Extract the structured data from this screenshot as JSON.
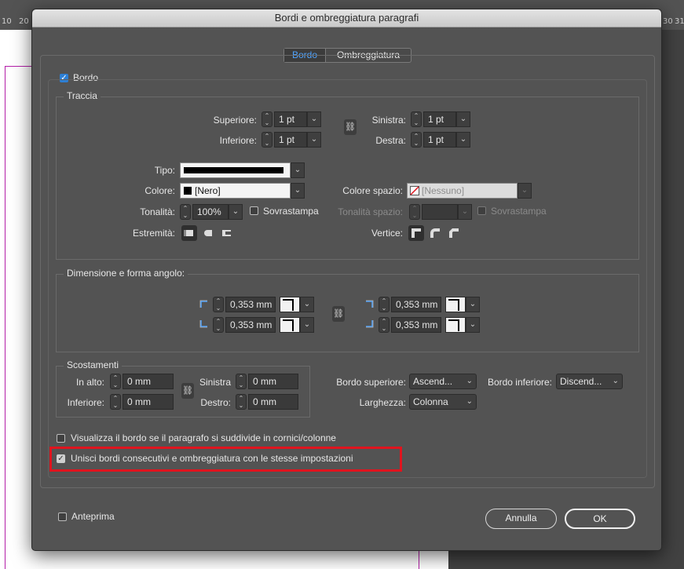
{
  "ruler": {
    "left_numbers": [
      "10",
      "20"
    ],
    "right_numbers": [
      "30",
      "31"
    ]
  },
  "dialog": {
    "title": "Bordi e ombreggiatura paragrafi",
    "tabs": [
      {
        "label": "Bordo",
        "active": true
      },
      {
        "label": "Ombreggiatura",
        "active": false
      }
    ],
    "border_checkbox": {
      "label": "Bordo",
      "checked": true
    },
    "stroke": {
      "group_label": "Traccia",
      "top_label": "Superiore:",
      "top_value": "1 pt",
      "bottom_label": "Inferiore:",
      "bottom_value": "1 pt",
      "left_label": "Sinistra:",
      "left_value": "1 pt",
      "right_label": "Destra:",
      "right_value": "1 pt",
      "type_label": "Tipo:",
      "color_label": "Colore:",
      "color_value": "[Nero]",
      "tint_label": "Tonalità:",
      "tint_value": "100%",
      "overprint_label": "Sovrastampa",
      "gap_color_label": "Colore spazio:",
      "gap_color_value": "[Nessuno]",
      "gap_tint_label": "Tonalità spazio:",
      "gap_overprint_label": "Sovrastampa",
      "caps_label": "Estremità:",
      "join_label": "Vertice:"
    },
    "corners": {
      "group_label": "Dimensione e forma angolo:",
      "top_left_value": "0,353 mm",
      "bottom_left_value": "0,353 mm",
      "top_right_value": "0,353 mm",
      "bottom_right_value": "0,353 mm"
    },
    "offsets": {
      "group_label": "Scostamenti",
      "top_label": "In alto:",
      "top_value": "0 mm",
      "bottom_label": "Inferiore:",
      "bottom_value": "0 mm",
      "left_label": "Sinistra",
      "left_value": "0 mm",
      "right_label": "Destro:",
      "right_value": "0 mm"
    },
    "border_top_label": "Bordo superiore:",
    "border_top_value": "Ascend...",
    "border_bottom_label": "Bordo inferiore:",
    "border_bottom_value": "Discend...",
    "width_label": "Larghezza:",
    "width_value": "Colonna",
    "split_checkbox": {
      "label": "Visualizza il bordo se il paragrafo si suddivide in cornici/colonne",
      "checked": false
    },
    "merge_checkbox": {
      "label": "Unisci bordi consecutivi e ombreggiatura con le stesse impostazioni",
      "checked": true
    },
    "preview_checkbox": {
      "label": "Anteprima",
      "checked": false
    },
    "cancel_label": "Annulla",
    "ok_label": "OK",
    "colors": {
      "accent": "#2d7fd4",
      "highlight": "#e0141e"
    }
  }
}
